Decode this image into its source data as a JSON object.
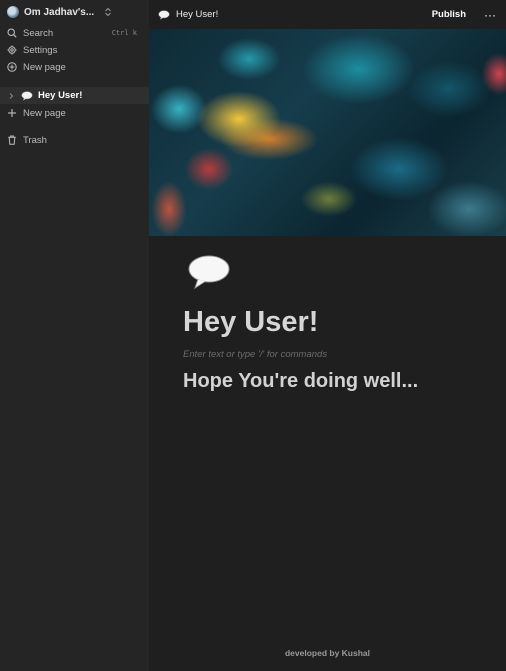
{
  "sidebar": {
    "workspace_name": "Om Jadhav's...",
    "search_label": "Search",
    "search_shortcut": "Ctrl k",
    "settings_label": "Settings",
    "new_page_label": "New page",
    "pages": [
      {
        "label": "Hey User!",
        "icon": "speech-bubble-icon"
      }
    ],
    "add_page_label": "New page",
    "trash_label": "Trash"
  },
  "topbar": {
    "breadcrumb": "Hey User!",
    "publish_label": "Publish",
    "more_label": "···"
  },
  "page": {
    "icon": "speech-bubble-icon",
    "title": "Hey User!",
    "placeholder": "Enter text or type '/' for commands",
    "heading": "Hope You're doing well...",
    "footer": "developed by Kushal"
  }
}
